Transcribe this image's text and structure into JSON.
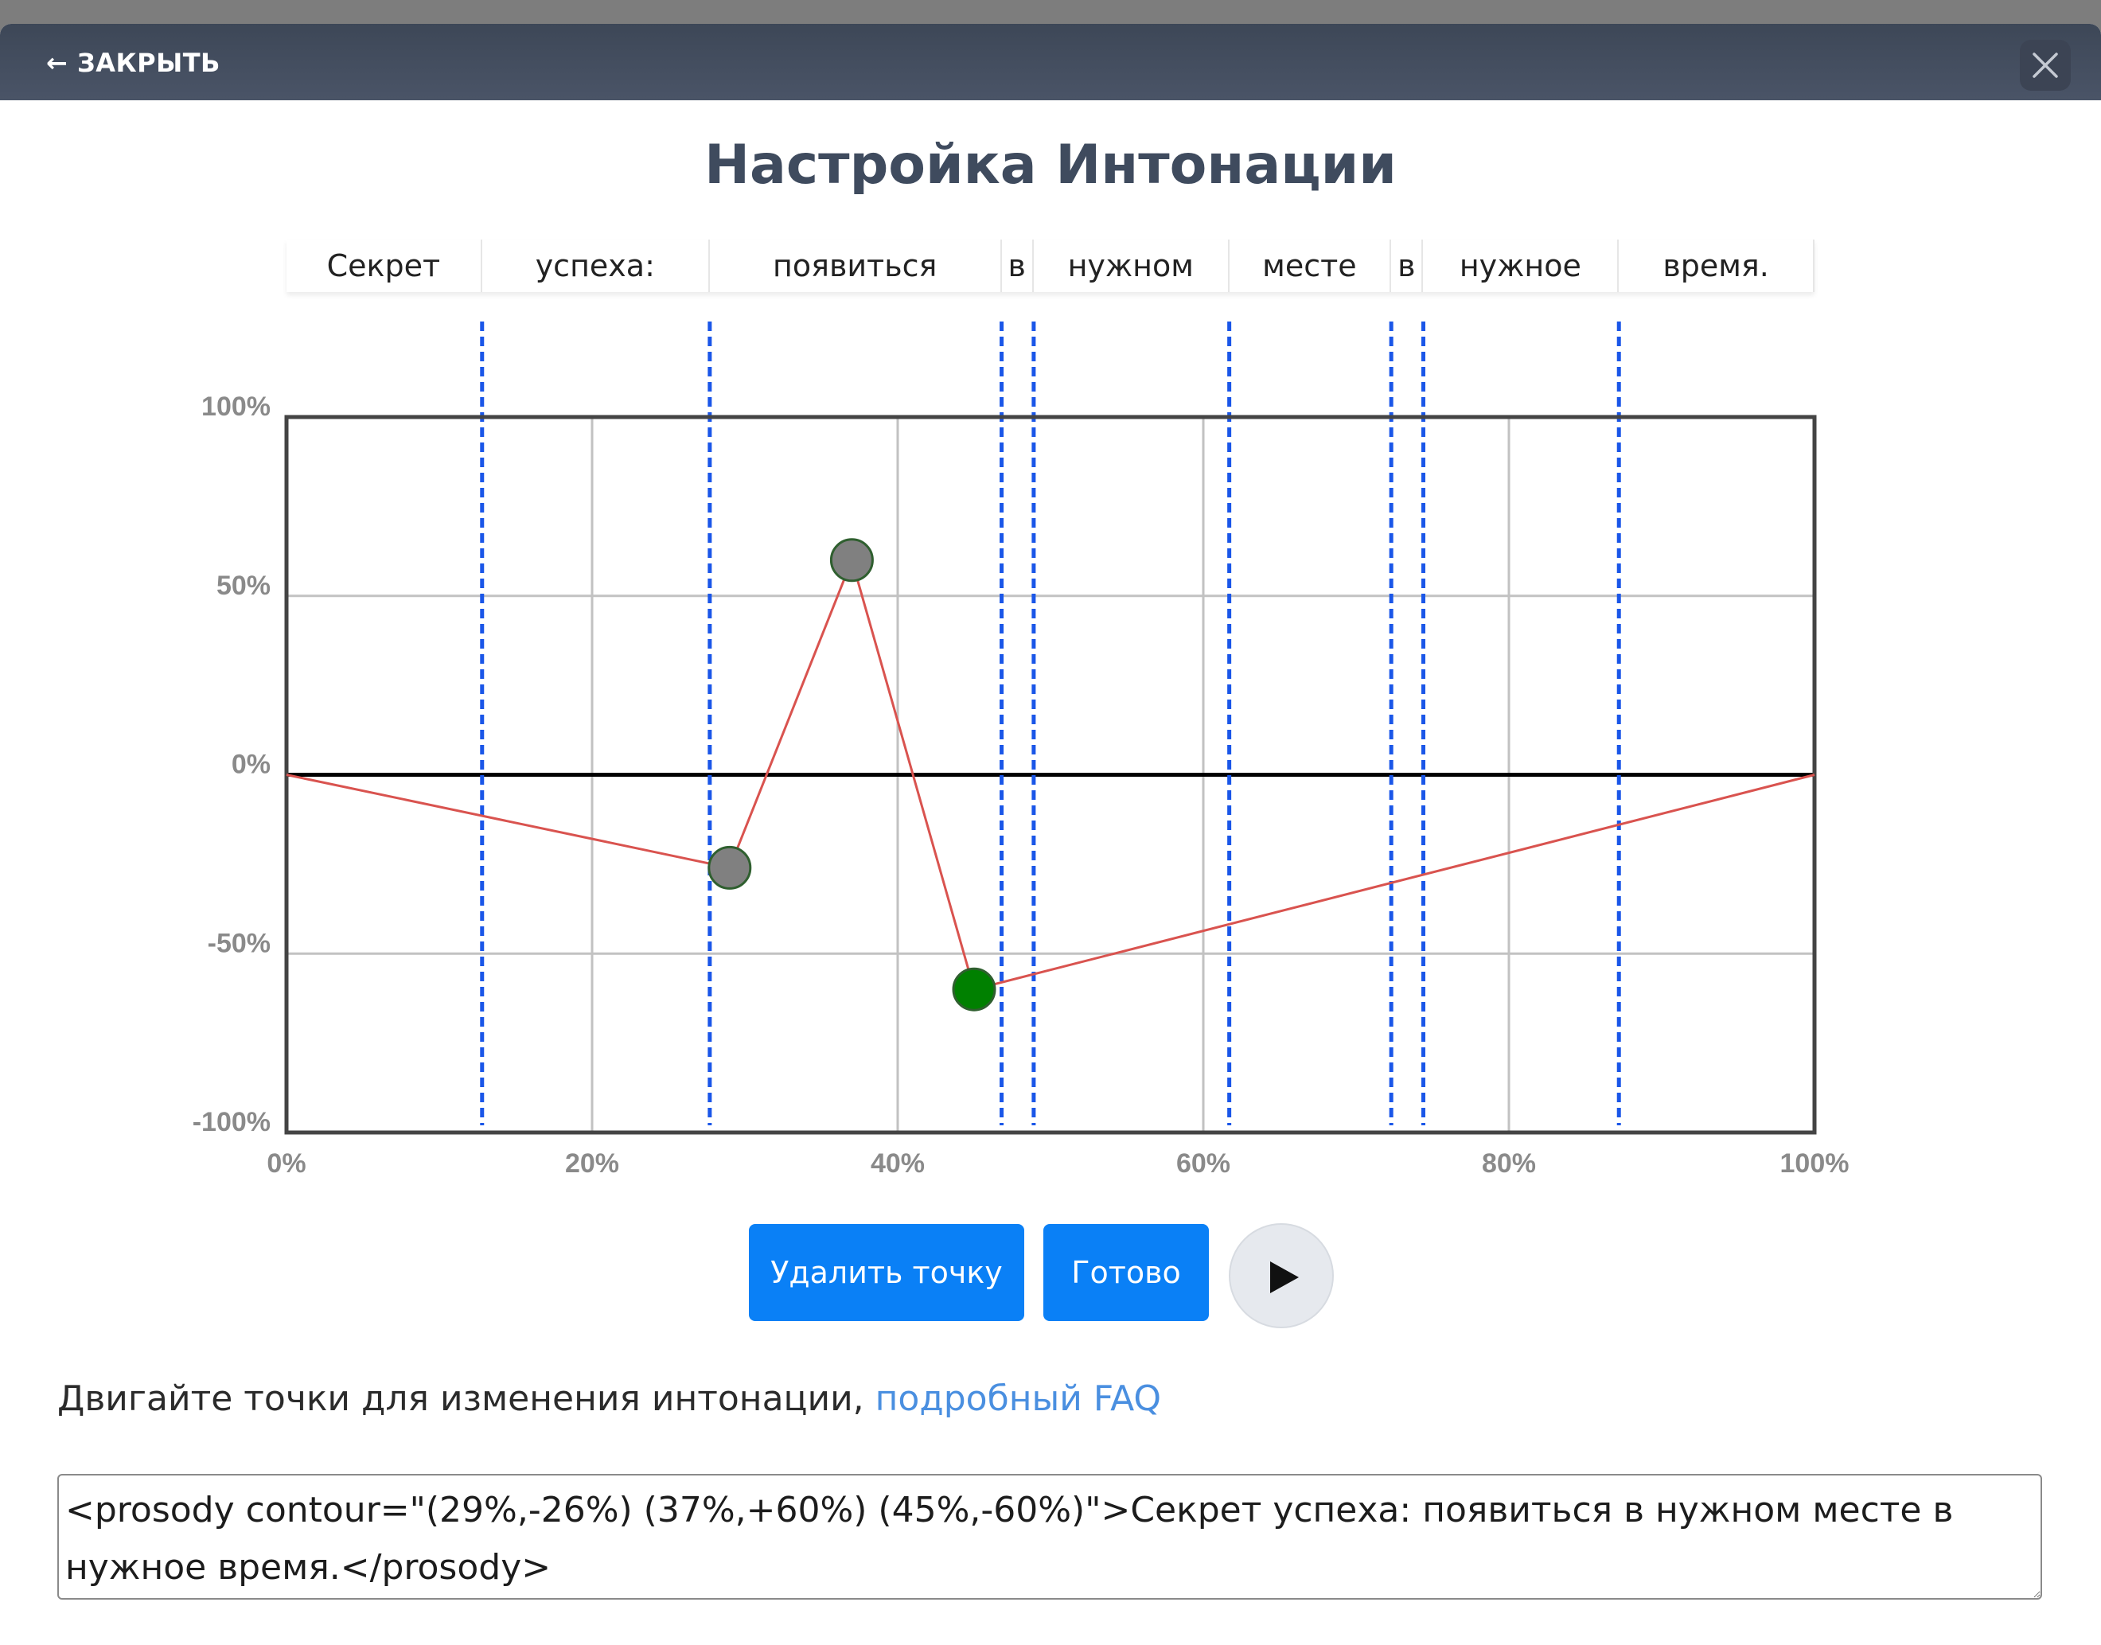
{
  "header": {
    "close_back_label": "← ЗАКРЫТЬ",
    "close_icon": "close-icon"
  },
  "title": "Настройка Интонации",
  "words": [
    "Секрет",
    "успеха:",
    "появиться",
    "в",
    "нужном",
    "месте",
    "в",
    "нужное",
    "время."
  ],
  "chart_data": {
    "type": "line",
    "x_tick_labels": [
      "0%",
      "20%",
      "40%",
      "60%",
      "80%",
      "100%"
    ],
    "y_tick_labels": [
      "100%",
      "50%",
      "0%",
      "-50%",
      "-100%"
    ],
    "xlim": [
      0,
      100
    ],
    "ylim": [
      -100,
      100
    ],
    "grid": true,
    "word_boundaries": [
      12.8,
      27.7,
      46.8,
      48.9,
      61.7,
      72.3,
      74.4,
      87.2
    ],
    "series": [
      {
        "color": "#d9534f",
        "points": [
          {
            "x": 0,
            "y": 0
          },
          {
            "x": 29,
            "y": -26
          },
          {
            "x": 37,
            "y": 60
          },
          {
            "x": 45,
            "y": -60
          },
          {
            "x": 100,
            "y": 0
          }
        ]
      }
    ],
    "handles": [
      {
        "x": 29,
        "y": -26,
        "color": "#808080"
      },
      {
        "x": 37,
        "y": 60,
        "color": "#808080"
      },
      {
        "x": 45,
        "y": -60,
        "color": "#008000"
      }
    ],
    "boundary_color": "#1a56e8"
  },
  "buttons": {
    "delete_point": "Удалить точку",
    "done": "Готово",
    "play_icon": "play-icon"
  },
  "hint": {
    "text": "Двигайте точки для изменения интонации, ",
    "link": "подробный FAQ"
  },
  "ssml_value": "<prosody contour=\"(29%,-26%) (37%,+60%) (45%,-60%)\">Секрет успеха: появиться в нужном месте в нужное время.</prosody>"
}
